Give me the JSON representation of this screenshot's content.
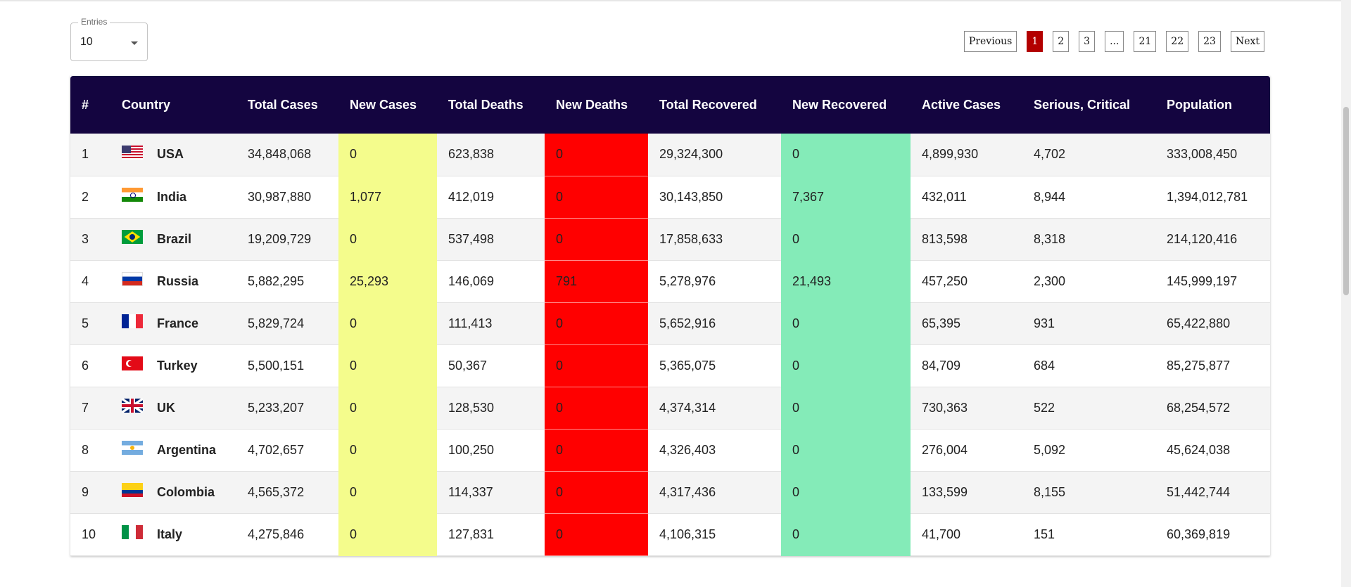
{
  "entries": {
    "legend": "Entries",
    "value": "10"
  },
  "pagination": {
    "previous": "Previous",
    "pages": [
      "1",
      "2",
      "3",
      "...",
      "21",
      "22",
      "23"
    ],
    "active": "1",
    "next": "Next"
  },
  "colors": {
    "header_bg": "#140540",
    "new_cases": "#f4fc8c",
    "new_deaths": "#ff0000",
    "new_recovered": "#84ebb8",
    "active_page": "#b30000"
  },
  "table": {
    "headers": [
      "#",
      "Country",
      "Total Cases",
      "New Cases",
      "Total Deaths",
      "New Deaths",
      "Total Recovered",
      "New Recovered",
      "Active Cases",
      "Serious, Critical",
      "Population"
    ],
    "rows": [
      {
        "rank": "1",
        "flag": "usa-flag-icon",
        "country": "USA",
        "total_cases": "34,848,068",
        "new_cases": "0",
        "total_deaths": "623,838",
        "new_deaths": "0",
        "total_recovered": "29,324,300",
        "new_recovered": "0",
        "active": "4,899,930",
        "critical": "4,702",
        "population": "333,008,450"
      },
      {
        "rank": "2",
        "flag": "india-flag-icon",
        "country": "India",
        "total_cases": "30,987,880",
        "new_cases": "1,077",
        "total_deaths": "412,019",
        "new_deaths": "0",
        "total_recovered": "30,143,850",
        "new_recovered": "7,367",
        "active": "432,011",
        "critical": "8,944",
        "population": "1,394,012,781"
      },
      {
        "rank": "3",
        "flag": "brazil-flag-icon",
        "country": "Brazil",
        "total_cases": "19,209,729",
        "new_cases": "0",
        "total_deaths": "537,498",
        "new_deaths": "0",
        "total_recovered": "17,858,633",
        "new_recovered": "0",
        "active": "813,598",
        "critical": "8,318",
        "population": "214,120,416"
      },
      {
        "rank": "4",
        "flag": "russia-flag-icon",
        "country": "Russia",
        "total_cases": "5,882,295",
        "new_cases": "25,293",
        "total_deaths": "146,069",
        "new_deaths": "791",
        "total_recovered": "5,278,976",
        "new_recovered": "21,493",
        "active": "457,250",
        "critical": "2,300",
        "population": "145,999,197"
      },
      {
        "rank": "5",
        "flag": "france-flag-icon",
        "country": "France",
        "total_cases": "5,829,724",
        "new_cases": "0",
        "total_deaths": "111,413",
        "new_deaths": "0",
        "total_recovered": "5,652,916",
        "new_recovered": "0",
        "active": "65,395",
        "critical": "931",
        "population": "65,422,880"
      },
      {
        "rank": "6",
        "flag": "turkey-flag-icon",
        "country": "Turkey",
        "total_cases": "5,500,151",
        "new_cases": "0",
        "total_deaths": "50,367",
        "new_deaths": "0",
        "total_recovered": "5,365,075",
        "new_recovered": "0",
        "active": "84,709",
        "critical": "684",
        "population": "85,275,877"
      },
      {
        "rank": "7",
        "flag": "uk-flag-icon",
        "country": "UK",
        "total_cases": "5,233,207",
        "new_cases": "0",
        "total_deaths": "128,530",
        "new_deaths": "0",
        "total_recovered": "4,374,314",
        "new_recovered": "0",
        "active": "730,363",
        "critical": "522",
        "population": "68,254,572"
      },
      {
        "rank": "8",
        "flag": "argentina-flag-icon",
        "country": "Argentina",
        "total_cases": "4,702,657",
        "new_cases": "0",
        "total_deaths": "100,250",
        "new_deaths": "0",
        "total_recovered": "4,326,403",
        "new_recovered": "0",
        "active": "276,004",
        "critical": "5,092",
        "population": "45,624,038"
      },
      {
        "rank": "9",
        "flag": "colombia-flag-icon",
        "country": "Colombia",
        "total_cases": "4,565,372",
        "new_cases": "0",
        "total_deaths": "114,337",
        "new_deaths": "0",
        "total_recovered": "4,317,436",
        "new_recovered": "0",
        "active": "133,599",
        "critical": "8,155",
        "population": "51,442,744"
      },
      {
        "rank": "10",
        "flag": "italy-flag-icon",
        "country": "Italy",
        "total_cases": "4,275,846",
        "new_cases": "0",
        "total_deaths": "127,831",
        "new_deaths": "0",
        "total_recovered": "4,106,315",
        "new_recovered": "0",
        "active": "41,700",
        "critical": "151",
        "population": "60,369,819"
      }
    ]
  }
}
